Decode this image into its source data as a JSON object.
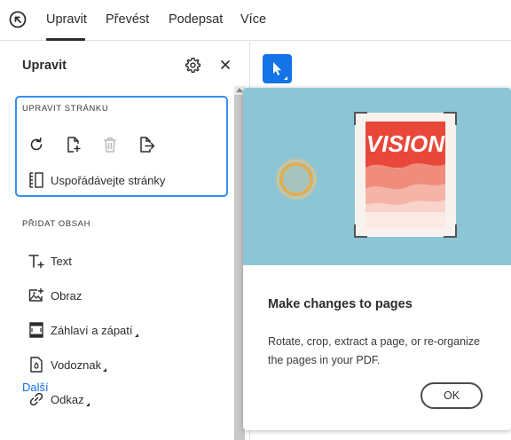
{
  "topbar": {
    "tabs": [
      {
        "label": "Upravit"
      },
      {
        "label": "Převést"
      },
      {
        "label": "Podepsat"
      },
      {
        "label": "Více"
      }
    ]
  },
  "panel": {
    "title": "Upravit",
    "edit_page_section": {
      "heading": "UPRAVIT STRÁNKU",
      "tools": [
        "rotate-icon",
        "insert-page-icon",
        "delete-icon",
        "extract-page-icon"
      ],
      "organize_label": "Uspořádávejte stránky"
    },
    "add_content_section": {
      "heading": "PŘIDAT OBSAH",
      "items": [
        {
          "label": "Text",
          "icon": "add-text-icon"
        },
        {
          "label": "Obraz",
          "icon": "add-image-icon"
        },
        {
          "label": "Záhlaví a zápatí",
          "icon": "header-footer-icon"
        },
        {
          "label": "Vodoznak",
          "icon": "watermark-icon"
        },
        {
          "label": "Odkaz",
          "icon": "link-icon"
        }
      ]
    },
    "more_link": "Další"
  },
  "callout": {
    "illustration_text": "VISION",
    "title": "Make changes to pages",
    "body": "Rotate, crop, extract a page, or re-organize the pages in your PDF.",
    "ok_label": "OK"
  },
  "colors": {
    "accent": "#1473e6",
    "focus_border": "#378ef0",
    "illustration_bg": "#8cc6d6",
    "poster_red": "#e8473a"
  }
}
